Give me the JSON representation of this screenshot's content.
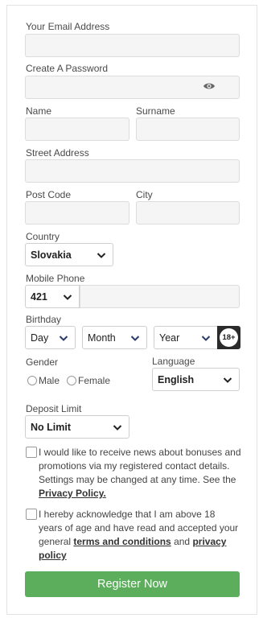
{
  "form": {
    "email_label": "Your Email Address",
    "email_value": "",
    "password_label": "Create A Password",
    "password_value": "",
    "name_label": "Name",
    "surname_label": "Surname",
    "street_label": "Street Address",
    "postcode_label": "Post Code",
    "city_label": "City",
    "country_label": "Country",
    "country_value": "Slovakia",
    "mobile_label": "Mobile Phone",
    "phone_code_value": "421",
    "birthday_label": "Birthday",
    "day_value": "Day",
    "month_value": "Month",
    "year_value": "Year",
    "age_badge": "18+",
    "gender_label": "Gender",
    "gender_male": "Male",
    "gender_female": "Female",
    "language_label": "Language",
    "language_value": "English",
    "deposit_label": "Deposit Limit",
    "deposit_value": "No Limit"
  },
  "consents": {
    "news_text": "I would like to receive news about bonuses and promotions via my registered contact details. Settings may be changed at any time. See the",
    "news_link": "Privacy Policy.",
    "terms_text_1": "I hereby acknowledge that I am above 18 years of age and have read and accepted your general",
    "terms_link": "terms and conditions",
    "terms_and": "and",
    "privacy_link": "privacy policy"
  },
  "submit_label": "Register Now",
  "colors": {
    "accent": "#5cad5c",
    "field_bg": "#f5f5f5"
  },
  "icons": {
    "password_toggle": "eye-icon",
    "dropdown": "chevron-down-icon",
    "age": "18-plus-badge-icon"
  }
}
